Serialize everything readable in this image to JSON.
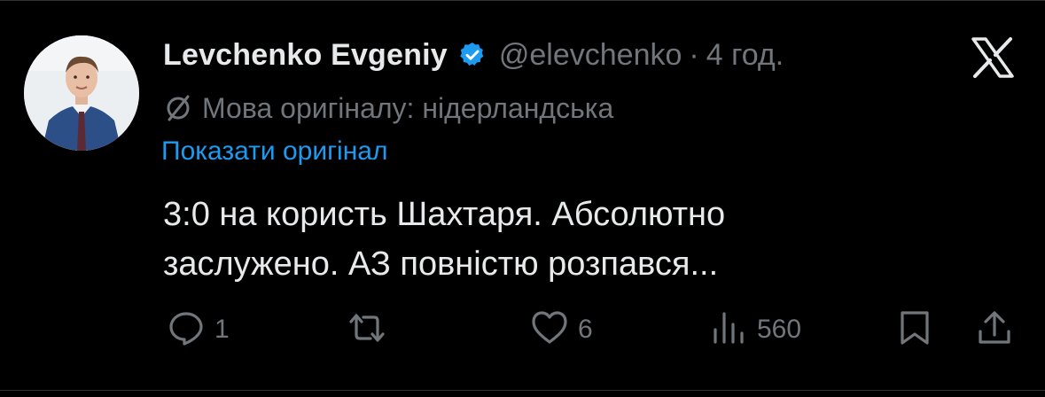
{
  "author": {
    "name": "Levchenko Evgeniy",
    "handle": "@elevchenko",
    "separator": "·",
    "time": "4 год."
  },
  "icons": {
    "verified": "verified-badge-icon",
    "x_logo": "x-logo-icon",
    "translate": "translate-icon",
    "reply": "reply-icon",
    "retweet": "retweet-icon",
    "like": "heart-icon",
    "views": "views-icon",
    "bookmark": "bookmark-icon",
    "share": "share-icon"
  },
  "translation": {
    "language_note": "Мова оригіналу: нідерландська",
    "show_original": "Показати оригінал"
  },
  "tweet": {
    "line1": "3:0 на користь Шахтаря. Абсолютно",
    "line2": "заслужено. АЗ повністю розпався..."
  },
  "stats": {
    "replies": "1",
    "likes": "6",
    "views": "560"
  },
  "colors": {
    "background": "#000000",
    "text": "#e7e9ea",
    "muted": "#71767b",
    "accent": "#1d9bf0"
  }
}
